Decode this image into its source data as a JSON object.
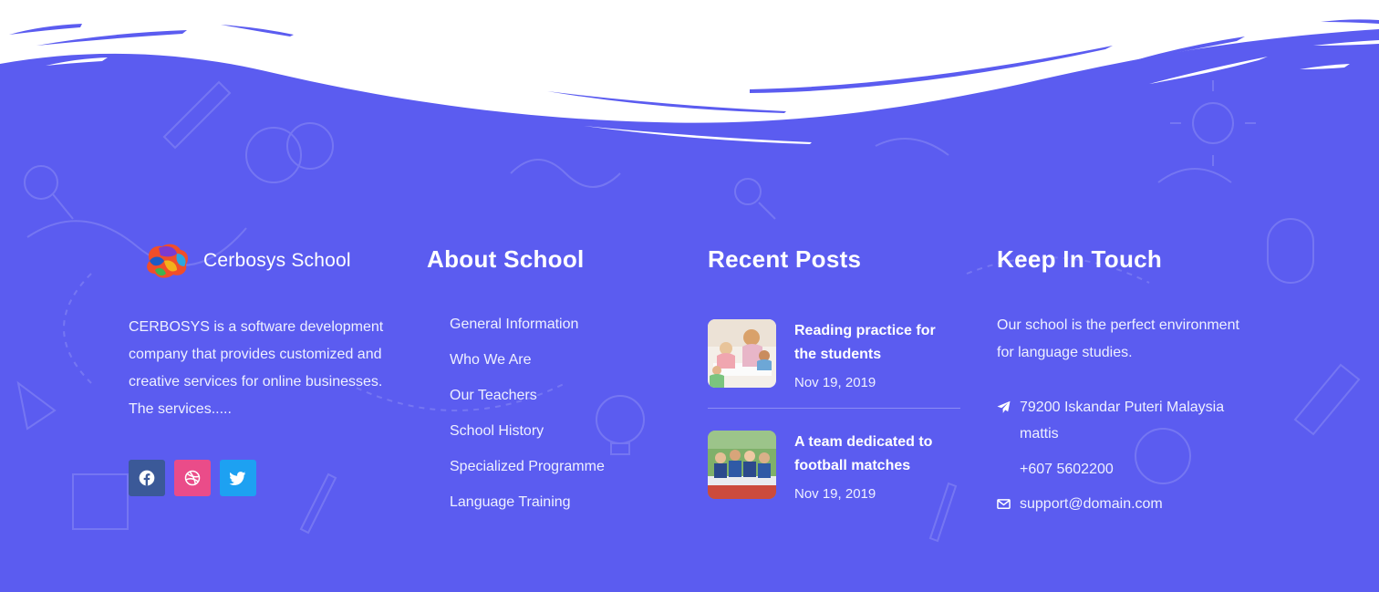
{
  "brand": {
    "name": "Cerbosys School"
  },
  "about": {
    "text": "CERBOSYS is a software development company that provides customized and creative services for online businesses. The services....."
  },
  "social": {
    "facebook": "facebook-icon",
    "dribbble": "dribbble-icon",
    "twitter": "twitter-icon",
    "colors": {
      "facebook": "#3b5998",
      "dribbble": "#ea4c89",
      "twitter": "#1da1f2"
    }
  },
  "about_school": {
    "heading": "About School",
    "links": [
      "General Information",
      "Who We Are",
      "Our Teachers",
      "School History",
      "Specialized Programme",
      "Language Training"
    ]
  },
  "recent_posts": {
    "heading": "Recent Posts",
    "posts": [
      {
        "title": "Reading practice for the students",
        "date": "Nov 19, 2019"
      },
      {
        "title": "A team dedicated to football matches",
        "date": "Nov 19, 2019"
      }
    ]
  },
  "keep_in_touch": {
    "heading": "Keep In Touch",
    "text": "Our school is the perfect environment for language studies.",
    "address": "79200 Iskandar Puteri Malaysia mattis",
    "phone": "+607 5602200",
    "email": "support@domain.com"
  },
  "colors": {
    "background": "#5b5cf0",
    "text": "#ffffff"
  }
}
